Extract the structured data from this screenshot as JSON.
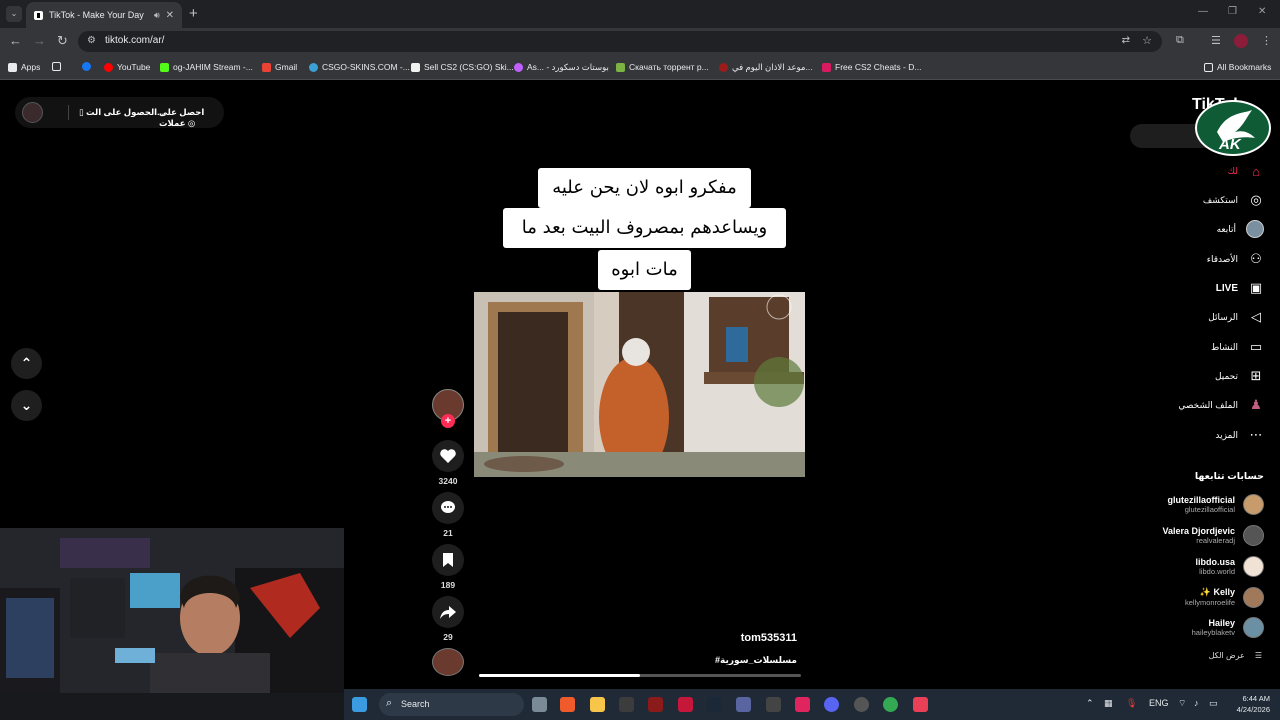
{
  "browser": {
    "tab_title": "TikTok - Make Your Day",
    "url": "tiktok.com/ar/",
    "bookmarks": [
      {
        "label": "Apps",
        "color": "#e8eaed"
      },
      {
        "label": "",
        "color": "#e8eaed"
      },
      {
        "label": "",
        "color": "#1877f2"
      },
      {
        "label": "YouTube",
        "color": "#ff0000"
      },
      {
        "label": "og-JAHIM Stream -...",
        "color": "#53fc18"
      },
      {
        "label": "Gmail",
        "color": "#ea4335"
      },
      {
        "label": "CSGO-SKINS.COM -...",
        "color": "#3ba0d6"
      },
      {
        "label": "Sell CS2 (CS:GO) Ski...",
        "color": "#f1f1f1"
      },
      {
        "label": "As... - بوستات دسكورد",
        "color": "#c061ff"
      },
      {
        "label": "Скачать торрент р...",
        "color": "#7cb342"
      },
      {
        "label": "موعد الاذان اليوم في...",
        "color": "#9c1c1c"
      },
      {
        "label": "Free CS2 Cheats - D...",
        "color": "#d81b60"
      }
    ],
    "all_bookmarks": "All Bookmarks"
  },
  "top_left": {
    "coins": "احصل على عملات",
    "get_app": "الحصول على الت..."
  },
  "caption": {
    "line1": "مفكرو ابوه لان يحن عليه",
    "line2": "ويساعدهم بمصروف البيت بعد ما",
    "line3": "مات ابوه"
  },
  "actions": {
    "likes": "3240",
    "comments": "21",
    "saves": "189",
    "shares": "29"
  },
  "video": {
    "username": "tom535311",
    "hashtag": "#مسلسلات_سورية",
    "progress": 0.5
  },
  "sidebar": {
    "logo": "TikTok",
    "nav": [
      {
        "label": "لك",
        "icon": "home-icon",
        "glyph": "⌂"
      },
      {
        "label": "استكشف",
        "icon": "compass-icon",
        "glyph": "◎"
      },
      {
        "label": "أتابعه",
        "icon": "following-avatar-icon",
        "glyph": "●"
      },
      {
        "label": "الأصدقاء",
        "icon": "friends-icon",
        "glyph": "⚇"
      },
      {
        "label": "LIVE",
        "icon": "live-icon",
        "glyph": "▣"
      },
      {
        "label": "الرسائل",
        "icon": "send-icon",
        "glyph": "◁"
      },
      {
        "label": "النشاط",
        "icon": "activity-icon",
        "glyph": "▭"
      },
      {
        "label": "تحميل",
        "icon": "upload-icon",
        "glyph": "⊞"
      },
      {
        "label": "الملف الشخصي",
        "icon": "profile-icon",
        "glyph": "♟"
      },
      {
        "label": "المزيد",
        "icon": "more-icon",
        "glyph": "⋯"
      }
    ],
    "following_header": "حسابات تتابعها",
    "following": [
      {
        "name": "glutezillaofficial",
        "handle": "glutezillaofficial",
        "color": "#c89b6a"
      },
      {
        "name": "Valera Djordjevic",
        "handle": "realvaleradj",
        "color": "#555"
      },
      {
        "name": "libdo.usa",
        "handle": "libdo.world",
        "color": "#f0e2d4"
      },
      {
        "name": "✨ Kelly",
        "handle": "kellymonroelife",
        "color": "#a0785a"
      },
      {
        "name": "Hailey",
        "handle": "haileyblaketv",
        "color": "#6b8fa3"
      }
    ],
    "see_all": "عرض الكل"
  },
  "taskbar": {
    "search": "Search",
    "lang": "ENG",
    "time": "6:44 AM",
    "date": "4/24/2026"
  },
  "colors": {
    "accent": "#fe2c55",
    "background": "#000000"
  }
}
